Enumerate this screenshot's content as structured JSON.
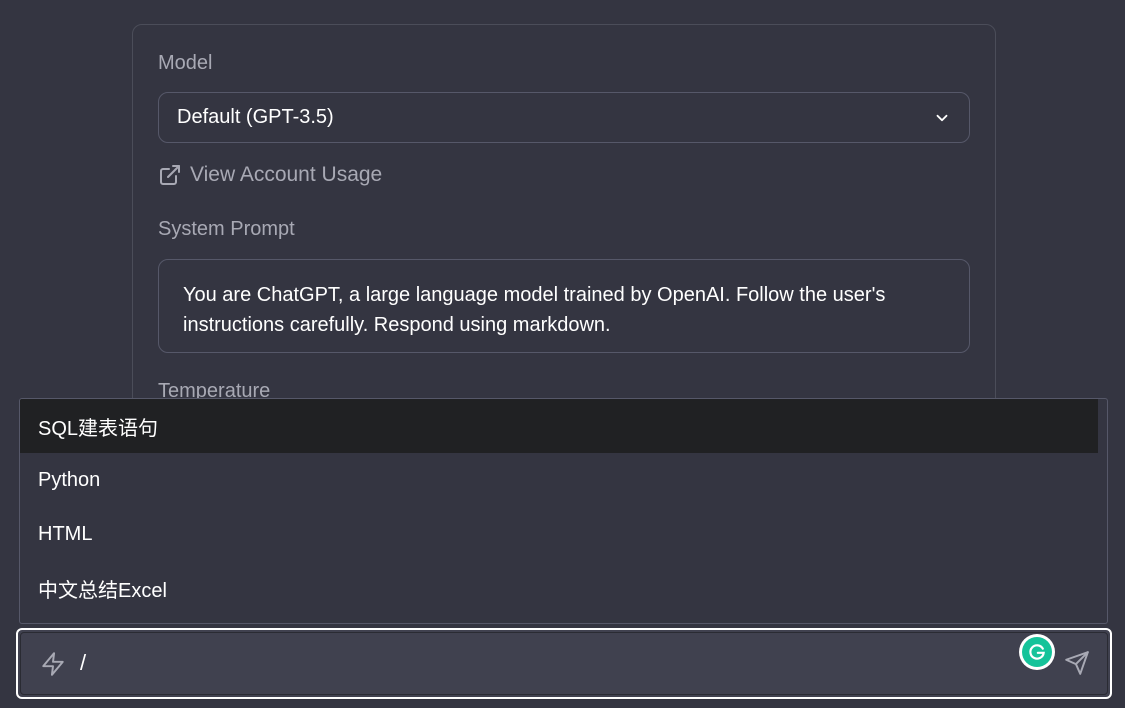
{
  "settings": {
    "model_label": "Model",
    "model_value": "Default (GPT-3.5)",
    "usage_link": "View Account Usage",
    "system_prompt_label": "System Prompt",
    "system_prompt_text": "You are ChatGPT, a large language model trained by OpenAI. Follow the user's instructions carefully. Respond using markdown.",
    "temperature_label": "Temperature"
  },
  "dropdown": {
    "items": [
      {
        "label": "SQL建表语句",
        "active": true
      },
      {
        "label": "Python",
        "active": false
      },
      {
        "label": "HTML",
        "active": false
      },
      {
        "label": "中文总结Excel",
        "active": false
      }
    ]
  },
  "input": {
    "value": "/"
  },
  "icons": {
    "model_select": "chevron-down-icon",
    "usage_link": "external-link-icon",
    "input_prefix": "bolt-icon",
    "extension": "grammarly-icon",
    "send": "send-icon"
  },
  "colors": {
    "background": "#343541",
    "input_bg": "#40414f",
    "active_item_bg": "#202123",
    "grammarly": "#15c39a"
  }
}
